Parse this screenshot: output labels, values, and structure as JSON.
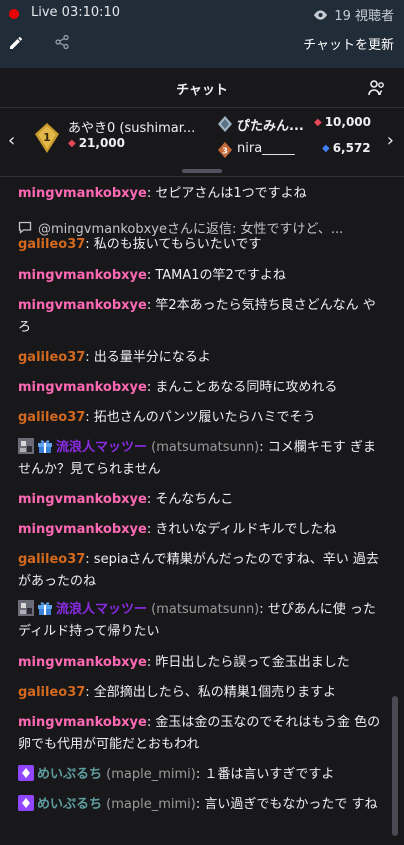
{
  "topbar": {
    "live_label": "Live 03:10:10",
    "viewer_count": "19 視聴者",
    "refresh_label": "チャットを更新",
    "live_color": "#eb0400"
  },
  "chat": {
    "title": "チャット"
  },
  "leaderboard": {
    "first": {
      "rank": "1",
      "name": "あやき0 (sushimar...",
      "score": "21,000"
    },
    "second": {
      "name": "ぴたみん...",
      "score": "10,000"
    },
    "third": {
      "rank": "3",
      "name": "nira_____",
      "score": "6,572"
    }
  },
  "messages": [
    {
      "user": "mingvmankobxye",
      "text": ": セピアさんは1つですよね"
    },
    {
      "reply": "@mingvmankobxyeさんに返信: 女性ですけど、..."
    },
    {
      "user": "galileo37",
      "text": ": 私のも抜いてもらいたいです"
    },
    {
      "user": "mingvmankobxye",
      "text": ": TAMA1の竿2ですよね"
    },
    {
      "user": "mingvmankobxye",
      "text": ": 竿2本あったら気持ち良さどんなん やろ"
    },
    {
      "user": "galileo37",
      "text": ": 出る量半分になるよ"
    },
    {
      "user": "mingvmankobxye",
      "text": ": まんことあなる同時に攻めれる"
    },
    {
      "user": "galileo37",
      "text": ": 拓也さんのパンツ履いたらハミでそう"
    },
    {
      "user": "流浪人マッツー",
      "login": "(matsumatsunn)",
      "text": ": コメ欄キモす ぎませんか？見てられません"
    },
    {
      "user": "mingvmankobxye",
      "text": ": そんなちんこ"
    },
    {
      "user": "mingvmankobxye",
      "text": ": きれいなディルドキルでしたね"
    },
    {
      "user": "galileo37",
      "text": ": sepiaさんで精巣がんだったのですね、辛い 過去があったのね"
    },
    {
      "user": "流浪人マッツー",
      "login": "(matsumatsunn)",
      "text": ": せぴあんに使 ったディルド持って帰りたい"
    },
    {
      "user": "mingvmankobxye",
      "text": ": 昨日出したら誤って金玉出ました"
    },
    {
      "user": "galileo37",
      "text": ": 全部摘出したら、私の精巣1個売りますよ"
    },
    {
      "user": "mingvmankobxye",
      "text": ": 金玉は金の玉なのでそれはもう金 色の卵でも代用が可能だとおもわれ"
    },
    {
      "user": "めいぷるち",
      "login": "(maple_mimi)",
      "text": ": １番は言いすぎですよ"
    },
    {
      "user": "めいぷるち",
      "login": "(maple_mimi)",
      "text": ": 言い過ぎでもなかったで すね"
    }
  ],
  "colors": {
    "mingvmankobxye": "#ff69b4",
    "galileo37": "#d2691e",
    "matsumatsunn": "#8a2be2",
    "maple_mimi": "#5f9ea0"
  },
  "icons": [
    "eye-icon",
    "pencil-icon",
    "share-icon",
    "users-icon",
    "chevron-left-icon",
    "chevron-right-icon",
    "reply-icon",
    "gift-badge-icon",
    "sub-badge-icon",
    "bits-badge-icon"
  ]
}
